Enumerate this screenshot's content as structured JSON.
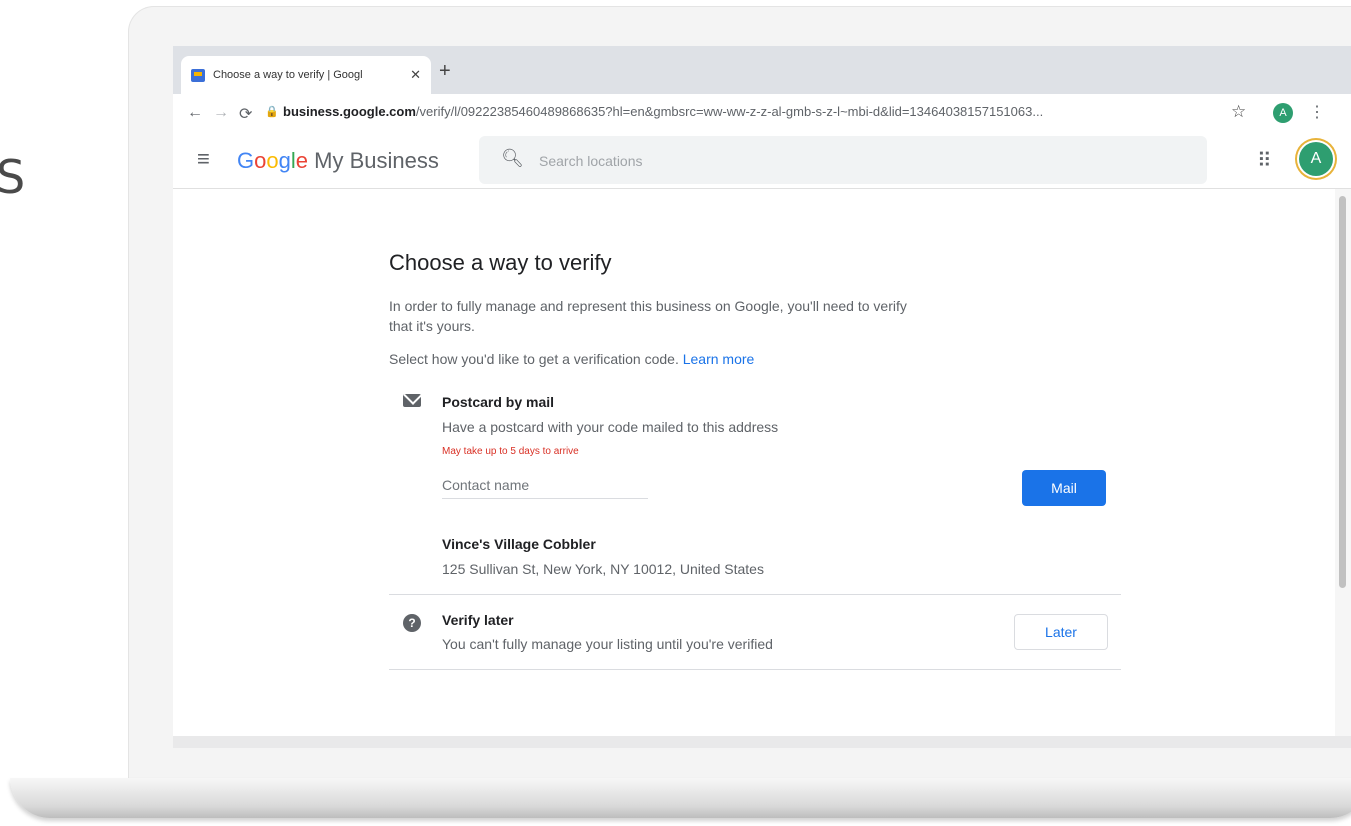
{
  "background_text": "S",
  "browser": {
    "tab_title": "Choose a way to verify | Googl",
    "tab_close": "✕",
    "new_tab": "+",
    "url_host": "business.google.com",
    "url_path": "/verify/l/09222385460489868635?hl=en&gmbsrc=ww-ww-z-z-al-gmb-s-z-l~mbi-d&lid=13464038157151063...",
    "profile_initial": "A"
  },
  "app": {
    "brand_suffix": " My Business",
    "search_placeholder": "Search locations",
    "avatar_initial": "A"
  },
  "page": {
    "title": "Choose a way to verify",
    "intro": "In order to fully manage and represent this business on Google, you'll need to verify that it's yours.",
    "select_prompt": "Select how you'd like to get a verification code. ",
    "learn_more": "Learn more",
    "postcard": {
      "title": "Postcard by mail",
      "description": "Have a postcard with your code mailed to this address",
      "warning": "May take up to 5 days to arrive",
      "contact_placeholder": "Contact name",
      "button_label": "Mail"
    },
    "business": {
      "name": "Vince's Village Cobbler",
      "address": "125 Sullivan St, New York, NY 10012, United States"
    },
    "verify_later": {
      "title": "Verify later",
      "description": "You can't fully manage your listing until you're verified",
      "button_label": "Later"
    }
  },
  "colors": {
    "primary": "#1a73e8",
    "warning": "#d93025",
    "avatar": "#2e9e70"
  }
}
